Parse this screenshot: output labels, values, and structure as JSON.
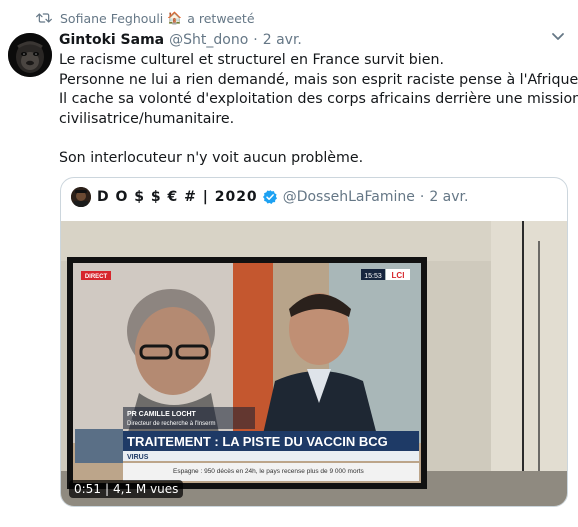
{
  "retweet": {
    "user": "Sofiane Feghouli",
    "emoji": "🏠",
    "label": "a retweeté"
  },
  "tweet": {
    "name": "Gintoki Sama",
    "handle": "@Sht_dono",
    "separator": "·",
    "time": "2 avr.",
    "lines": [
      "Le racisme culturel et structurel en France survit bien.",
      "Personne ne lui a rien demandé, mais son esprit raciste pense à l'Afrique...",
      "Il cache sa volonté d'exploitation des corps africains derrière une mission",
      "civilisatrice/humanitaire.",
      "Son interlocuteur n'y voit aucun problème."
    ]
  },
  "quoted": {
    "name": "D O $ $ € # | 2020",
    "handle": "@DossehLaFamine",
    "separator": "·",
    "time": "2 avr.",
    "video": {
      "duration": "0:51",
      "separator": "|",
      "views": "4,1 M vues",
      "tv": {
        "live_badge": "DIRECT",
        "clock": "15:53",
        "channel": "LCI",
        "speaker_name": "PR CAMILLE LOCHT",
        "speaker_title": "Directeur de recherche à l'Inserm",
        "headline": "TRAITEMENT : LA PISTE DU VACCIN BCG",
        "section": "VIRUS",
        "ticker": "Espagne : 950 décès en 24h, le pays recense plus de 9 000 morts"
      }
    }
  },
  "colors": {
    "text": "#14171a",
    "secondary": "#657786",
    "border": "#ccd6dd",
    "verified": "#1da1f2",
    "tv_banner": "#1e3a66"
  }
}
